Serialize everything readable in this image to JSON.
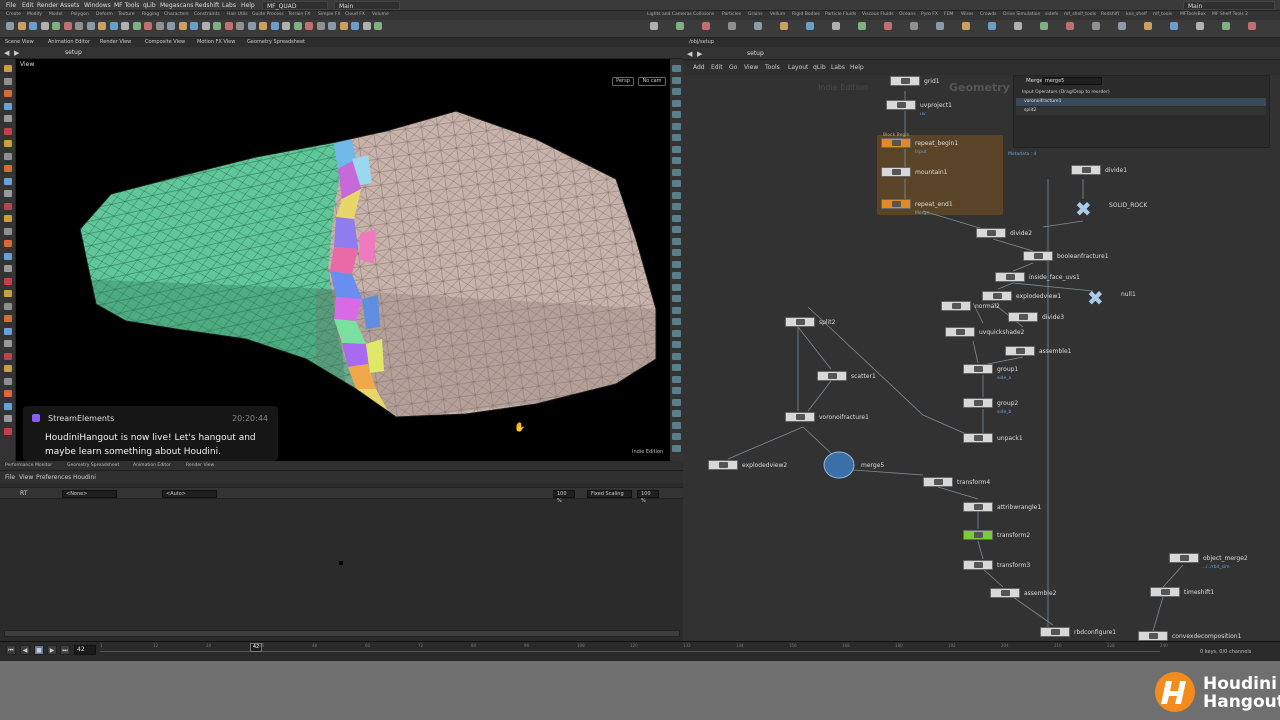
{
  "menubar": {
    "items": [
      "File",
      "Edit",
      "Render",
      "Assets",
      "Windows",
      "MF Tools",
      "qLib",
      "Megascans",
      "Redshift",
      "Labs",
      "Help"
    ],
    "desktop": "MF_QUAD",
    "take": "Main",
    "right_take": "Main"
  },
  "shelf_tabs_left": [
    "Create",
    "Modify",
    "Model",
    "Polygon",
    "Deform",
    "Texture",
    "Rigging",
    "Characters",
    "Constraints",
    "Hair Utils",
    "Guide Process",
    "Terrain FX",
    "Simple FX",
    "Cloud FX",
    "Volume"
  ],
  "shelf_tabs_right": [
    "Lights and Cameras",
    "Collisions",
    "Particles",
    "Grains",
    "Vellum",
    "Rigid Bodies",
    "Particle Fluids",
    "Viscous Fluids",
    "Oceans",
    "Pyro FX",
    "FEM",
    "Wires",
    "Crowds",
    "Drive Simulation",
    "sidefx",
    "mf_shelf_tools",
    "Redshift",
    "kns_shelf",
    "mf_tools",
    "MFToolsBox",
    "MF Shelf Tools 2"
  ],
  "pane_tabs_left": [
    "Scene View",
    "Animation Editor",
    "Render View",
    "Composite View",
    "Motion FX View",
    "Geometry Spreadsheet"
  ],
  "viewport": {
    "path": "setup",
    "title": "View",
    "persp_label": "Persp",
    "cam_label": "No cam",
    "edition": "Indie Edition"
  },
  "notification": {
    "source": "StreamElements",
    "time": "20:20:44",
    "message": "HoudiniHangout is now live! Let's hangout and maybe learn something about Houdini.",
    "accent": "#8a5cf6"
  },
  "bottom_tabs": [
    "Performance Monitor",
    "Geometry Spreadsheet",
    "Animation Editor",
    "Render View"
  ],
  "bottom_menu": [
    "File",
    "View",
    "Preferences",
    "Houdini"
  ],
  "bottom_toolbar": {
    "rt_label": "RT",
    "none_option": "<None>",
    "auto_option": "<Auto>",
    "zoom1": "100 %",
    "scaling": "Fixed Scaling",
    "zoom2": "100 %"
  },
  "network": {
    "path_tab": "/obj/setup",
    "path": "setup",
    "menu": [
      "Add",
      "Edit",
      "Go",
      "View",
      "Tools",
      "Layout",
      "qLib",
      "Labs",
      "Help"
    ],
    "context_label": "Geometry",
    "edition_label": "Indie Edition",
    "param": {
      "type": "Merge",
      "name": "merge5",
      "header": "Input Operators (Drag/Drop to reorder)",
      "inputs": [
        "voronoifracture1",
        "split2"
      ]
    },
    "nodes": [
      {
        "name": "grid1",
        "sub": ""
      },
      {
        "name": "uvproject1",
        "sub": "uv"
      },
      {
        "name": "repeat_begin1",
        "sub": "Input"
      },
      {
        "name": "mountain1",
        "sub": ""
      },
      {
        "name": "repeat_end1",
        "sub": "Merge"
      },
      {
        "name": "divide1",
        "sub": ""
      },
      {
        "name": "SOLID_ROCK",
        "sub": ""
      },
      {
        "name": "divide2",
        "sub": ""
      },
      {
        "name": "booleanfracture1",
        "sub": ""
      },
      {
        "name": "inside_face_uvs1",
        "sub": ""
      },
      {
        "name": "explodedview1",
        "sub": ""
      },
      {
        "name": "null1",
        "sub": ""
      },
      {
        "name": "normal2",
        "sub": ""
      },
      {
        "name": "uvquickshade2",
        "sub": ""
      },
      {
        "name": "divide3",
        "sub": ""
      },
      {
        "name": "assemble1",
        "sub": ""
      },
      {
        "name": "split2",
        "sub": ""
      },
      {
        "name": "scatter1",
        "sub": ""
      },
      {
        "name": "group1",
        "sub": "side_a"
      },
      {
        "name": "group2",
        "sub": "side_b"
      },
      {
        "name": "voronoifracture1",
        "sub": ""
      },
      {
        "name": "unpack1",
        "sub": ""
      },
      {
        "name": "explodedview2",
        "sub": ""
      },
      {
        "name": "merge5",
        "sub": ""
      },
      {
        "name": "transform4",
        "sub": ""
      },
      {
        "name": "attribwrangle1",
        "sub": ""
      },
      {
        "name": "transform2",
        "sub": ""
      },
      {
        "name": "transform3",
        "sub": ""
      },
      {
        "name": "assemble2",
        "sub": ""
      },
      {
        "name": "object_merge2",
        "sub": "../../rbd_sim"
      },
      {
        "name": "timeshift1",
        "sub": ""
      },
      {
        "name": "rbdconfigure1",
        "sub": ""
      },
      {
        "name": "convexdecomposition1",
        "sub": ""
      }
    ],
    "block_labels": {
      "begin": "Block Begin",
      "end": "Block End",
      "metadata": "Metadata : 4"
    }
  },
  "timeline": {
    "frame": "42",
    "ticks": [
      "1",
      "12",
      "24",
      "36",
      "48",
      "60",
      "72",
      "84",
      "96",
      "108",
      "120",
      "132",
      "144",
      "156",
      "168",
      "180",
      "192",
      "204",
      "216",
      "228",
      "240"
    ],
    "keys": "0 keys, 0/0 channels"
  },
  "brand": {
    "line1": "Houdini",
    "line2": "Hangout",
    "color": "#f28c1e"
  }
}
